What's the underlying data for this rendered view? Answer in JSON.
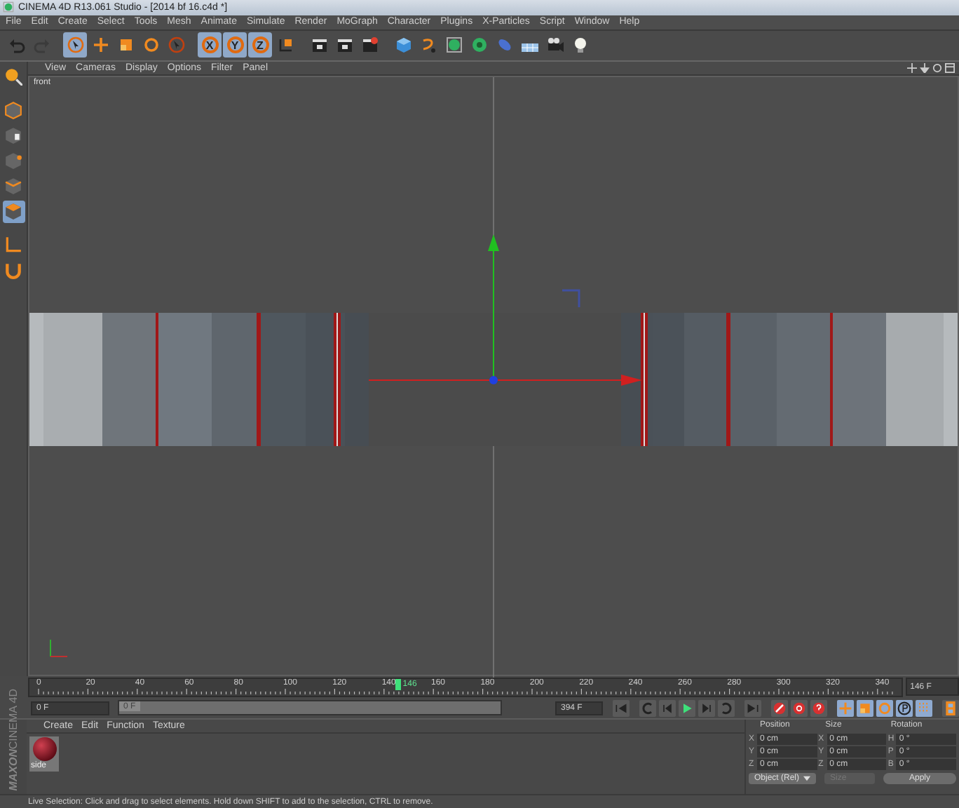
{
  "window": {
    "title": "CINEMA 4D R13.061 Studio - [2014 bf 16.c4d *]"
  },
  "menu": [
    "File",
    "Edit",
    "Create",
    "Select",
    "Tools",
    "Mesh",
    "Animate",
    "Simulate",
    "Render",
    "MoGraph",
    "Character",
    "Plugins",
    "X-Particles",
    "Script",
    "Window",
    "Help"
  ],
  "toolbar": [
    [
      {
        "kind": "undo",
        "selected": false,
        "disabled": false
      },
      {
        "kind": "redo",
        "selected": false,
        "disabled": true
      }
    ],
    [
      {
        "kind": "cursor",
        "selected": true,
        "disabled": false
      },
      {
        "kind": "move",
        "selected": false,
        "disabled": false
      },
      {
        "kind": "scale",
        "selected": false,
        "disabled": false
      },
      {
        "kind": "rotate",
        "selected": false,
        "disabled": false
      },
      {
        "kind": "cursor-circle",
        "selected": false,
        "disabled": false
      }
    ],
    [
      {
        "kind": "axis",
        "label": "X",
        "selected": true,
        "disabled": false
      },
      {
        "kind": "axis",
        "label": "Y",
        "selected": true,
        "disabled": false
      },
      {
        "kind": "axis",
        "label": "Z",
        "selected": true,
        "disabled": false
      },
      {
        "kind": "coord",
        "selected": false,
        "disabled": false
      }
    ],
    [
      {
        "kind": "clapper",
        "selected": false,
        "disabled": false
      },
      {
        "kind": "clapper",
        "selected": false,
        "disabled": false
      },
      {
        "kind": "clapper-gear",
        "selected": false,
        "disabled": false
      }
    ],
    [
      {
        "kind": "cube",
        "selected": false,
        "disabled": false
      },
      {
        "kind": "spline",
        "selected": false,
        "disabled": false
      },
      {
        "kind": "subdiv",
        "selected": false,
        "disabled": false
      },
      {
        "kind": "array",
        "selected": false,
        "disabled": false
      },
      {
        "kind": "deformer",
        "selected": false,
        "disabled": false
      },
      {
        "kind": "floor",
        "selected": false,
        "disabled": false
      },
      {
        "kind": "camera",
        "selected": false,
        "disabled": false
      },
      {
        "kind": "light",
        "selected": false,
        "disabled": false
      }
    ]
  ],
  "left_tools": [
    [
      {
        "kind": "make-editable",
        "selected": false
      }
    ],
    [
      {
        "kind": "model",
        "selected": false
      },
      {
        "kind": "texture",
        "selected": false
      },
      {
        "kind": "point",
        "selected": false
      },
      {
        "kind": "edge",
        "selected": false
      },
      {
        "kind": "polygon",
        "selected": true
      }
    ],
    [
      {
        "kind": "axis-tool",
        "selected": false
      },
      {
        "kind": "magnet",
        "selected": false
      }
    ]
  ],
  "viewport": {
    "menu": [
      "View",
      "Cameras",
      "Display",
      "Options",
      "Filter",
      "Panel"
    ],
    "camera_label": "front"
  },
  "timeline": {
    "ticks": [
      "0",
      "20",
      "40",
      "60",
      "80",
      "100",
      "120",
      "140",
      "160",
      "180",
      "200",
      "220",
      "240",
      "260",
      "280",
      "300",
      "320",
      "340"
    ],
    "playhead": {
      "label": "146",
      "level": 0.42
    },
    "current_field": "146 F"
  },
  "transport": {
    "start_field": "0 F",
    "slider": {
      "label": "0 F",
      "level": 0
    },
    "end_field": "394 F",
    "buttons": [
      {
        "kind": "go-start"
      },
      {
        "kind": "prev-key"
      },
      {
        "kind": "step-back"
      },
      {
        "kind": "play"
      },
      {
        "kind": "step-forward"
      },
      {
        "kind": "next-key"
      },
      {
        "kind": "go-end"
      },
      {
        "kind": "record"
      },
      {
        "kind": "auto-key"
      },
      {
        "kind": "key-help"
      }
    ],
    "modes": [
      {
        "kind": "move",
        "selected": true
      },
      {
        "kind": "scale",
        "selected": true
      },
      {
        "kind": "rotate",
        "selected": true
      },
      {
        "kind": "param",
        "selected": true
      },
      {
        "kind": "grid",
        "selected": true
      },
      {
        "kind": "timeline",
        "selected": false
      }
    ]
  },
  "logo": {
    "brand": "MAXON",
    "product": "CINEMA 4D"
  },
  "materials": {
    "menu": [
      "Create",
      "Edit",
      "Function",
      "Texture"
    ],
    "items": [
      {
        "name": "side"
      }
    ]
  },
  "coordinates": {
    "headers": [
      "Position",
      "Size",
      "Rotation"
    ],
    "rows": [
      {
        "axes": [
          "X",
          "X",
          "H"
        ],
        "values": [
          "0 cm",
          "0 cm",
          "0 °"
        ]
      },
      {
        "axes": [
          "Y",
          "Y",
          "P"
        ],
        "values": [
          "0 cm",
          "0 cm",
          "0 °"
        ]
      },
      {
        "axes": [
          "Z",
          "Z",
          "B"
        ],
        "values": [
          "0 cm",
          "0 cm",
          "0 °"
        ]
      }
    ],
    "mode": "Object (Rel)",
    "size_mode": {
      "label": "Size",
      "disabled": true
    },
    "apply": "Apply"
  },
  "status_bar": "Live Selection: Click and drag to select elements. Hold down SHIFT to add to the selection, CTRL to remove."
}
